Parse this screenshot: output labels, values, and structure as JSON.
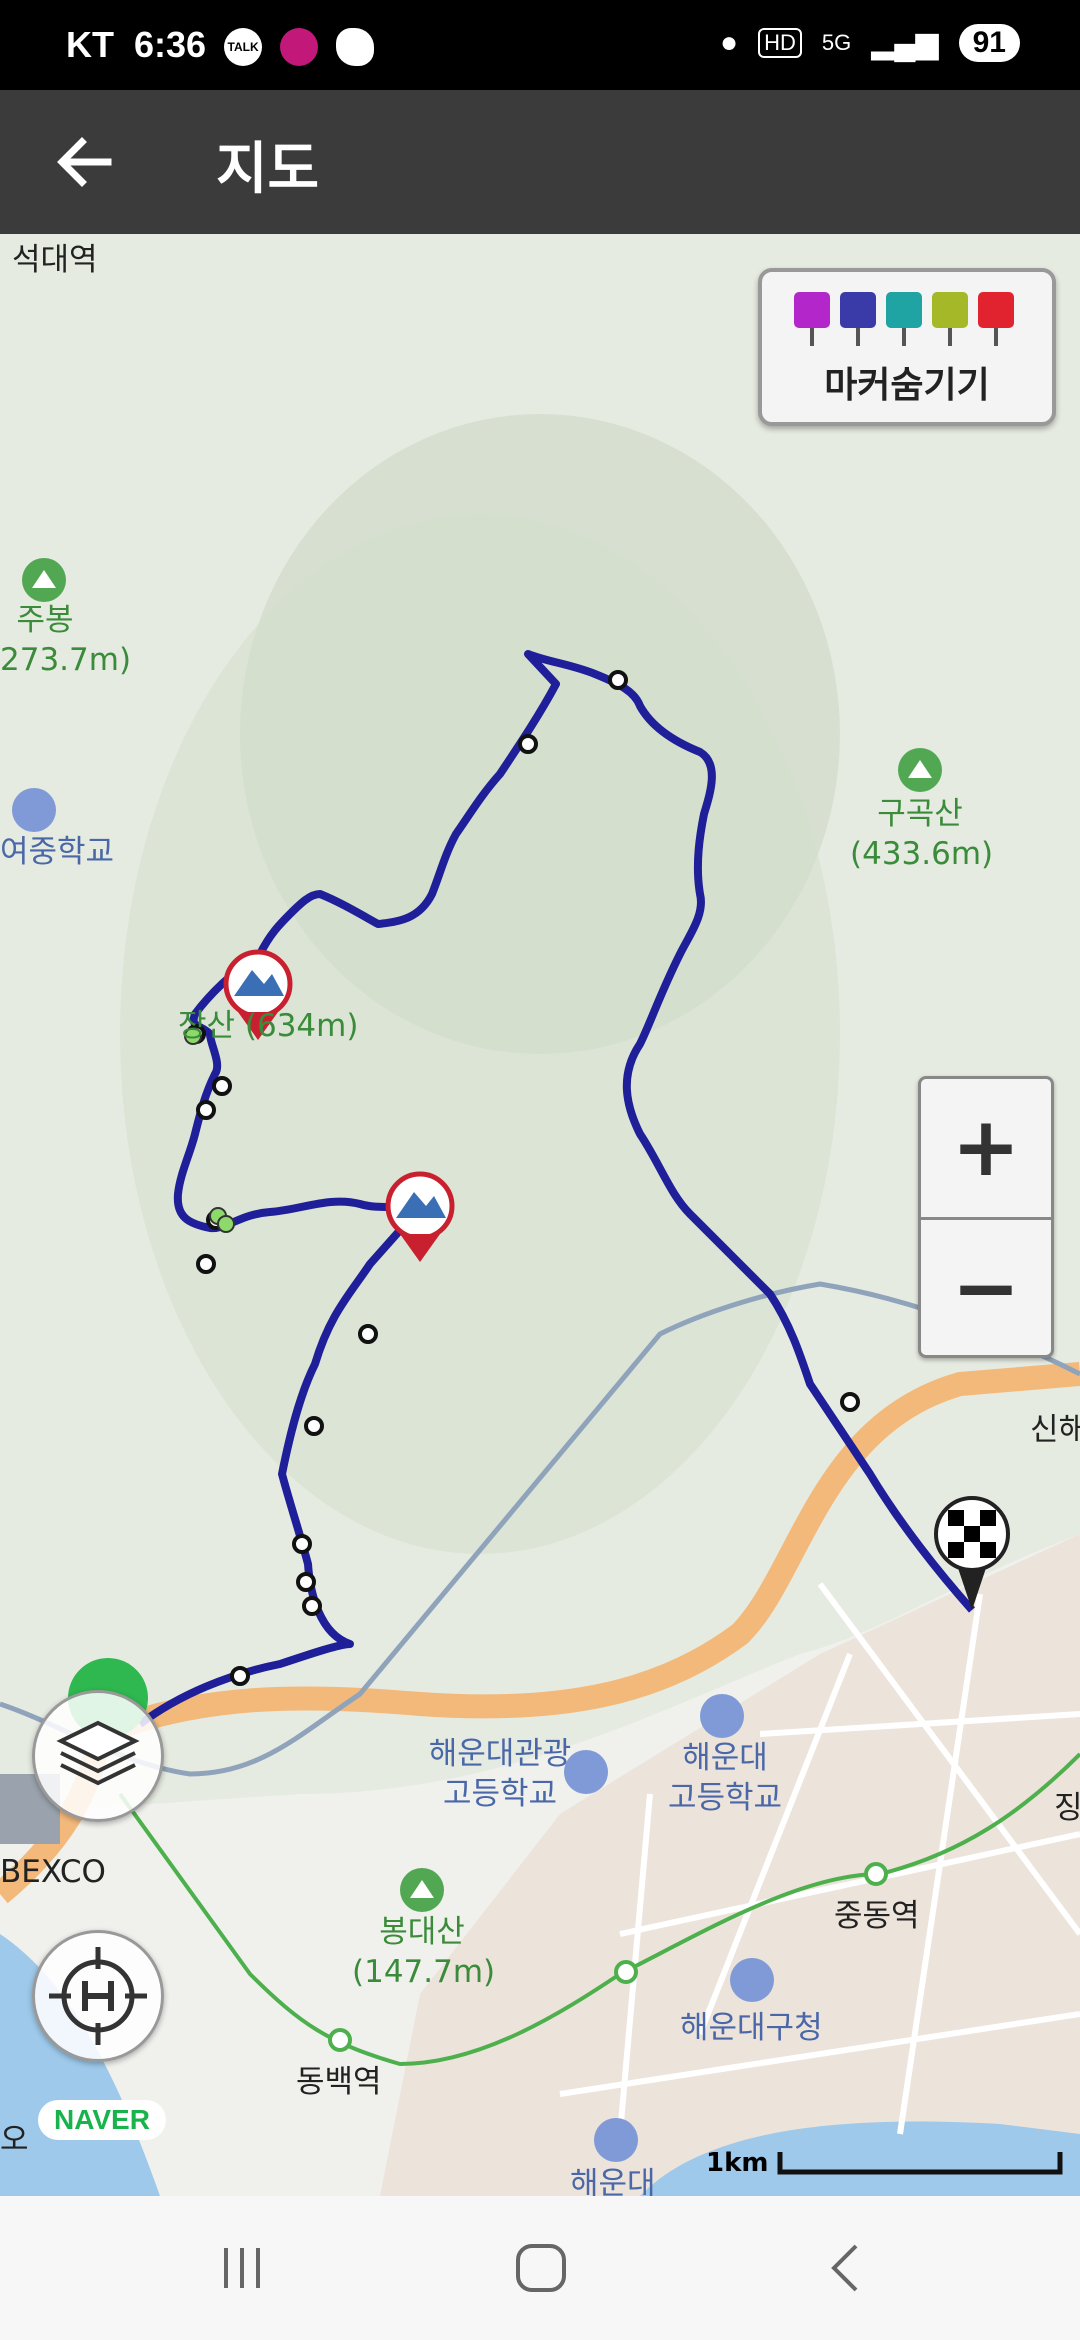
{
  "status_bar": {
    "carrier": "KT",
    "time": "6:36",
    "notif_talk": "TALK",
    "notif_busan": "Busan is good",
    "network": "5G",
    "hd": "HD",
    "battery": "91"
  },
  "header": {
    "title": "지도",
    "back_icon": "arrow-left-icon"
  },
  "marker_toggle": {
    "label": "마커숨기기",
    "marker_colors": [
      "#b326c9",
      "#3a3aa8",
      "#1fa3a3",
      "#a5b828",
      "#e0232e"
    ]
  },
  "zoom": {
    "in_label": "+",
    "out_label": "−"
  },
  "map_labels": {
    "station_top": "석대역",
    "peak_jubong_name": "주봉",
    "peak_jubong_height": "273.7m)",
    "school_left": "여중학교",
    "peak_jangsan": "장산 (634m)",
    "peak_gugoksan_name": "구곡산",
    "peak_gugoksan_height": "(433.6m)",
    "shinhae": "신해",
    "school_gwangwang_1": "해운대관광",
    "school_gwangwang_2": "고등학교",
    "school_haeundae_1": "해운대",
    "school_haeundae_2": "고등학교",
    "bexco": "BEXCO",
    "peak_bongdae_name": "봉대산",
    "peak_bongdae_height": "(147.7m)",
    "station_jungdong": "중동역",
    "station_dongbaek": "동백역",
    "office_haeundae": "해운대구청",
    "beach_haeundae": "해운대",
    "edge_jing": "징",
    "edge_o": "오"
  },
  "scale_label": "1km",
  "naver_logo": "NAVER",
  "route_color": "#1f1f99"
}
